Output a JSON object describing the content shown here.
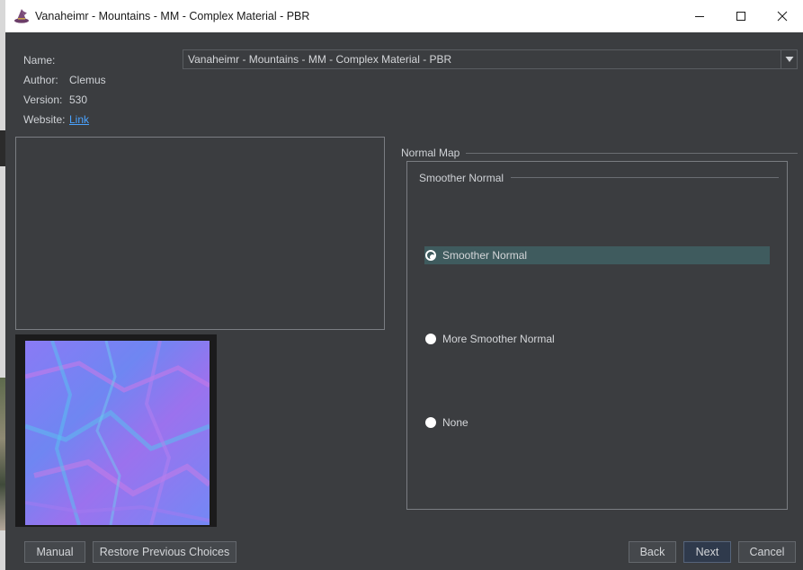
{
  "window": {
    "title": "Vanaheimr - Mountains - MM - Complex Material - PBR",
    "icon": "wizard-hat-icon"
  },
  "info": {
    "name_label": "Name:",
    "author_label": "Author:",
    "author_value": "Clemus",
    "version_label": "Version:",
    "version_value": "530",
    "website_label": "Website:",
    "website_value": "Link"
  },
  "name_select": {
    "value": "Vanaheimr - Mountains - MM - Complex Material - PBR"
  },
  "group": {
    "title": "Normal Map",
    "subgroup_title": "Smoother Normal",
    "options": [
      {
        "label": "Smoother Normal",
        "selected": true
      },
      {
        "label": "More Smoother Normal",
        "selected": false
      },
      {
        "label": "None",
        "selected": false
      }
    ]
  },
  "buttons": {
    "manual": "Manual",
    "restore": "Restore Previous Choices",
    "back": "Back",
    "next": "Next",
    "cancel": "Cancel"
  },
  "colors": {
    "background": "#3b3d40",
    "selection": "#3f5b5e",
    "link": "#4aa3ff"
  }
}
